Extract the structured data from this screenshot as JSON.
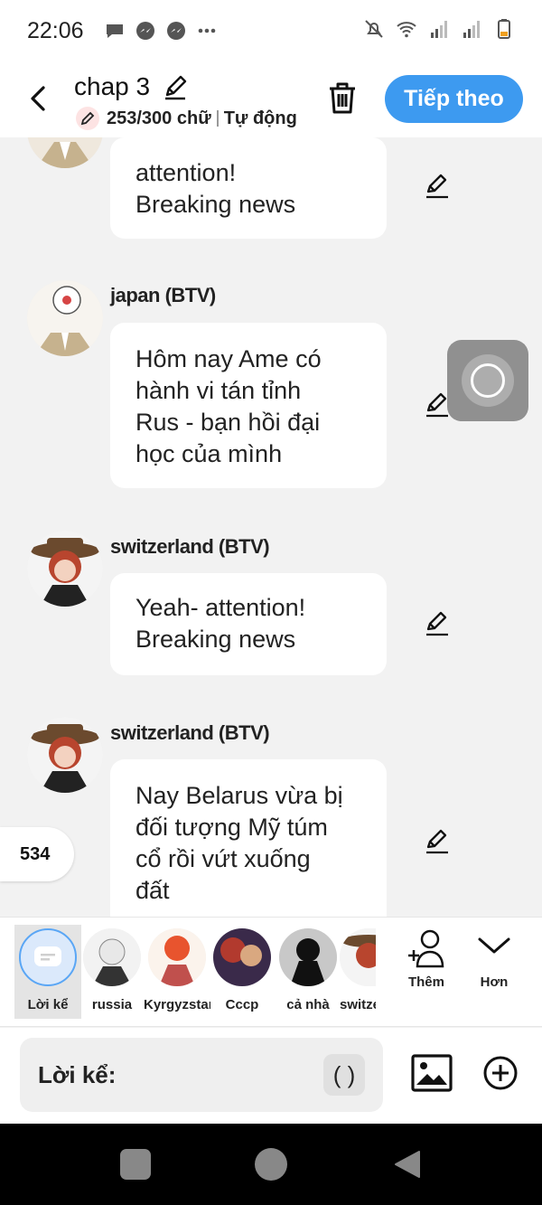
{
  "status_bar": {
    "time": "22:06"
  },
  "header": {
    "title": "chap 3",
    "word_count": "253/300 chữ",
    "mode": "Tự động",
    "next_label": "Tiếp theo"
  },
  "messages": [
    {
      "author": "",
      "lines": [
        "attention!",
        "Breaking news"
      ]
    },
    {
      "author": "japan (BTV)",
      "lines": [
        "Hôm nay Ame có",
        "hành vi tán tỉnh",
        "Rus - bạn hồi đại",
        "học của mình"
      ]
    },
    {
      "author": "switzerland (BTV)",
      "lines": [
        "Yeah- attention!",
        "Breaking news"
      ]
    },
    {
      "author": "switzerland (BTV)",
      "lines": [
        "Nay Belarus vừa bị",
        "đối tượng Mỹ túm",
        "cổ rồi vứt xuống",
        "đất"
      ]
    }
  ],
  "count_badge": "534",
  "characters": [
    {
      "label": "Lời kể"
    },
    {
      "label": "russia"
    },
    {
      "label": "Kyrgyzstan"
    },
    {
      "label": "Cccp"
    },
    {
      "label": "cả nhà"
    },
    {
      "label": "switze"
    }
  ],
  "actions": {
    "add_label": "Thêm",
    "more_label": "Hơn"
  },
  "composer": {
    "label": "Lời kể:",
    "paren": "( )"
  },
  "colors": {
    "accent": "#3d9af0",
    "background": "#f2f2f2"
  }
}
